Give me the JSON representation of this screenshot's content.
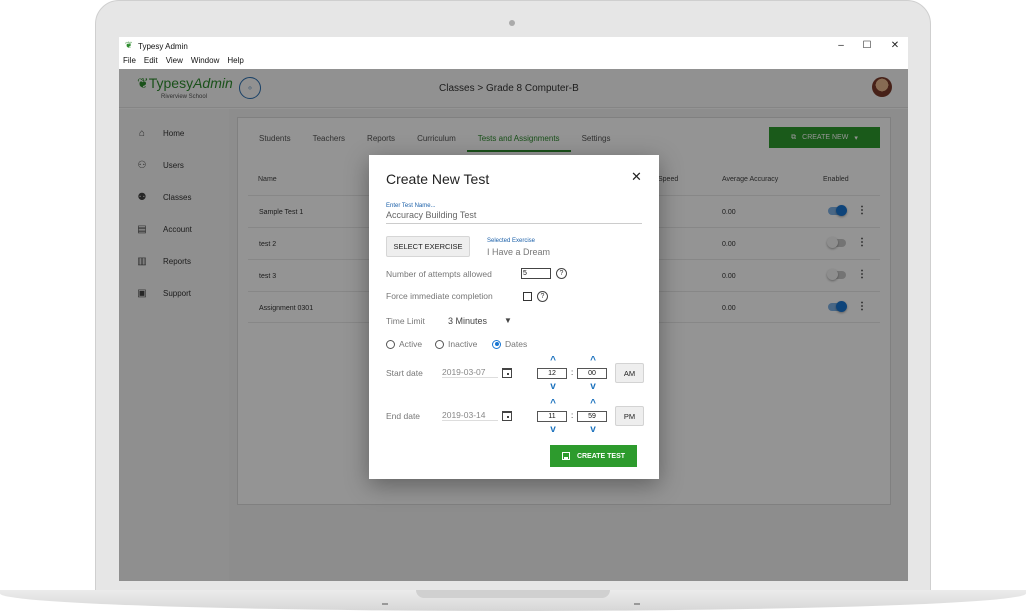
{
  "window": {
    "title": "Typesy Admin",
    "controls": [
      "–",
      "☐",
      "✕"
    ]
  },
  "menu": [
    "File",
    "Edit",
    "View",
    "Window",
    "Help"
  ],
  "header": {
    "logo_main": "Typesy",
    "logo_admin": "Admin",
    "school": "Riverview School",
    "breadcrumb": "Classes  >  Grade 8 Computer-B"
  },
  "sidebar": {
    "items": [
      {
        "label": "Home",
        "icon": "⌂"
      },
      {
        "label": "Users",
        "icon": "⚇"
      },
      {
        "label": "Classes",
        "icon": "⚉"
      },
      {
        "label": "Account",
        "icon": "▤"
      },
      {
        "label": "Reports",
        "icon": "▥"
      },
      {
        "label": "Support",
        "icon": "▣"
      }
    ]
  },
  "tabs": [
    "Students",
    "Teachers",
    "Reports",
    "Curriculum",
    "Tests and Assignments",
    "Settings"
  ],
  "active_tab": "Tests and Assignments",
  "create_new_label": "CREATE NEW",
  "table": {
    "headers": {
      "name": "Name",
      "speed": "Speed",
      "accuracy": "Average Accuracy",
      "enabled": "Enabled"
    },
    "rows": [
      {
        "name": "Sample Test 1",
        "accuracy": "0.00",
        "enabled": true
      },
      {
        "name": "test 2",
        "accuracy": "0.00",
        "enabled": false
      },
      {
        "name": "test 3",
        "accuracy": "0.00",
        "enabled": false
      },
      {
        "name": "Assignment 0301",
        "accuracy": "0.00",
        "enabled": true
      }
    ]
  },
  "modal": {
    "title": "Create New Test",
    "close": "✕",
    "name_label": "Enter Test Name...",
    "name_value": "Accuracy Building Test",
    "select_exercise_label": "SELECT EXERCISE",
    "selected_exercise_label": "Selected Exercise",
    "selected_exercise_value": "I Have a Dream",
    "attempts_label": "Number of attempts allowed",
    "attempts_value": "5",
    "force_label": "Force immediate completion",
    "force_checked": false,
    "time_limit_label": "Time Limit",
    "time_limit_value": "3 Minutes",
    "status_options": [
      "Active",
      "Inactive",
      "Dates"
    ],
    "status_selected": "Dates",
    "start_label": "Start date",
    "start_date": "2019-03-07",
    "start_hour": "12",
    "start_min": "00",
    "start_ampm": "AM",
    "end_label": "End date",
    "end_date": "2019-03-14",
    "end_hour": "11",
    "end_min": "59",
    "end_ampm": "PM",
    "create_label": "CREATE TEST"
  },
  "colors": {
    "accent_green": "#2d9b2d",
    "accent_blue": "#1976d2"
  }
}
